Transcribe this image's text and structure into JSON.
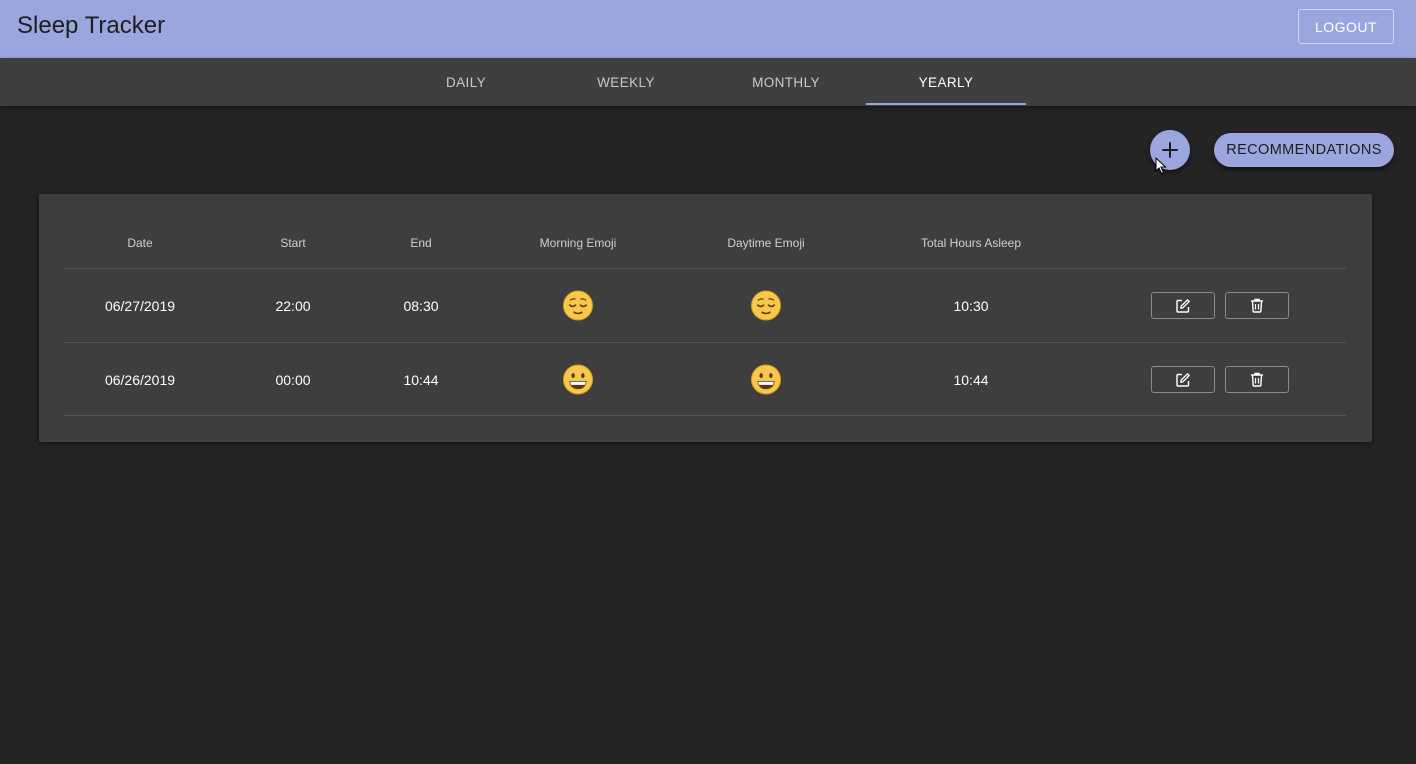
{
  "app": {
    "title": "Sleep Tracker",
    "logout_label": "LOGOUT"
  },
  "tabs": [
    {
      "label": "DAILY",
      "active": false
    },
    {
      "label": "WEEKLY",
      "active": false
    },
    {
      "label": "MONTHLY",
      "active": false
    },
    {
      "label": "YEARLY",
      "active": true
    }
  ],
  "actions": {
    "add_icon": "plus-icon",
    "recommendations_label": "RECOMMENDATIONS"
  },
  "table": {
    "columns": [
      "Date",
      "Start",
      "End",
      "Morning Emoji",
      "Daytime Emoji",
      "Total Hours Asleep"
    ],
    "rows": [
      {
        "date": "06/27/2019",
        "start": "22:00",
        "end": "08:30",
        "morning_emoji": "relieved-face",
        "daytime_emoji": "relieved-face",
        "total": "10:30"
      },
      {
        "date": "06/26/2019",
        "start": "00:00",
        "end": "10:44",
        "morning_emoji": "grinning-face",
        "daytime_emoji": "grinning-face",
        "total": "10:44"
      }
    ],
    "row_actions": {
      "edit_icon": "edit-icon",
      "delete_icon": "trash-icon"
    }
  },
  "colors": {
    "accent": "#9ca6de",
    "background": "#242424",
    "surface": "#3e3e3e",
    "tab_bar": "#3f3f3f"
  }
}
